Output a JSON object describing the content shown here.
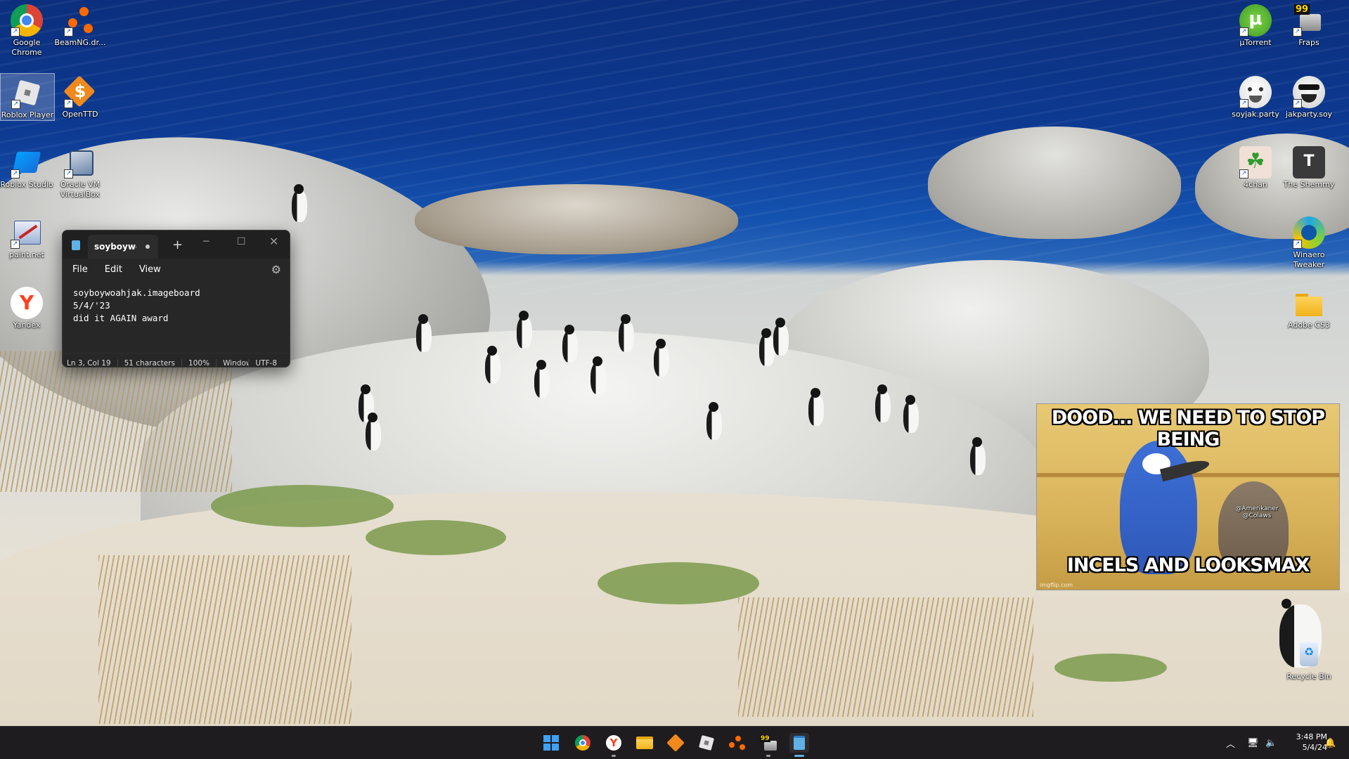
{
  "desktop_icons": {
    "chrome": "Google Chrome",
    "beamng": "BeamNG.dr...",
    "roblox_player": "Roblox Player",
    "openttd": "OpenTTD",
    "roblox_studio": "Roblox Studio",
    "virtualbox": "Oracle VM VirtualBox",
    "paintnet": "paint.net",
    "yandex": "Yandex",
    "utorrent": "µTorrent",
    "fraps": "Fraps",
    "soyjak_party": "soyjak.party",
    "jakparty_soy": "jakparty.soy",
    "fourchan": "4chan",
    "shemmy": "The Shemmy",
    "winaero": "Winaero Tweaker",
    "adobe": "Adobe CS3",
    "recycle": "Recycle Bin",
    "fraps_badge": "99",
    "shemmy_letter": "T"
  },
  "notepad": {
    "tab_title": "soyboywoahjak.imageboard",
    "menu": {
      "file": "File",
      "edit": "Edit",
      "view": "View"
    },
    "lines": [
      "soyboywoahjak.imageboard",
      "5/4/'23",
      "did it AGAIN award"
    ],
    "status": {
      "position": "Ln 3, Col 19",
      "chars": "51 characters",
      "zoom": "100%",
      "eol": "Windows (CRLF)",
      "encoding": "UTF-8"
    }
  },
  "meme": {
    "top_text": "DOOD... WE NEED TO STOP BEING",
    "bottom_text": "INCELS AND LOOKSMAX",
    "tag": "@Amerikaner @Colaws",
    "watermark": "imgflip.com"
  },
  "taskbar": {
    "start_icon": "windows-logo",
    "fraps_badge": "99"
  },
  "clock": {
    "time": "3:48 PM",
    "date": "5/4/24"
  }
}
